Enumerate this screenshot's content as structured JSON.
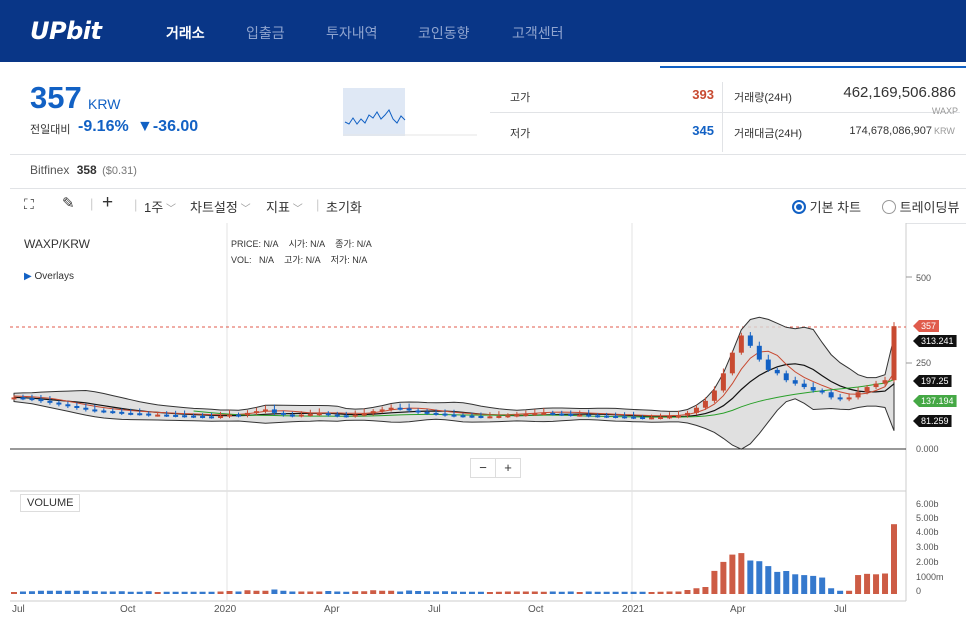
{
  "nav": {
    "logo": "UPbit",
    "items": [
      "거래소",
      "입출금",
      "투자내역",
      "코인동향",
      "고객센터"
    ]
  },
  "ticker": {
    "price": "357",
    "unit": "KRW",
    "prev_label": "전일대비",
    "change_pct": "-9.16%",
    "change_abs": "▼-36.00",
    "high_label": "고가",
    "high": "393",
    "low_label": "저가",
    "low": "345",
    "vol_label": "거래량(24H)",
    "vol_value": "462,169,506.886",
    "vol_unit": "WAXP",
    "amt_label": "거래대금(24H)",
    "amt_value": "174,678,086,907",
    "amt_unit": "KRW"
  },
  "bitfinex": {
    "label": "Bitfinex",
    "price": "358",
    "usd": "($0.31)"
  },
  "toolbar": {
    "interval": "1주",
    "chart_settings": "차트설정",
    "indicators": "지표",
    "reset": "초기화",
    "basic_chart": "기본 차트",
    "trading_view": "트레이딩뷰"
  },
  "chart": {
    "symbol": "WAXP/KRW",
    "overlays": "Overlays",
    "legend": {
      "price": "PRICE:",
      "open": "시가:",
      "close": "종가:",
      "vol": "VOL:",
      "high": "고가:",
      "low": "저가:",
      "na": "N/A"
    },
    "volume_label": "VOLUME",
    "price_axis": [
      "500",
      "250",
      "0.000"
    ],
    "price_tags": [
      "357",
      "313.241",
      "197.25",
      "137.194",
      "81.259"
    ],
    "volume_axis": [
      "6.00b",
      "5.00b",
      "4.00b",
      "3.00b",
      "2.00b",
      "1000m",
      "0"
    ],
    "x_axis": [
      "Jul",
      "Oct",
      "2020",
      "Apr",
      "Jul",
      "Oct",
      "2021",
      "Apr",
      "Jul"
    ],
    "zoom_out": "−",
    "zoom_in": "+",
    "colors": {
      "up": "#c84a31",
      "down": "#1261c4",
      "band": "#d8d8d8",
      "ma_green": "#2aa02a",
      "ma_red": "#c84a31"
    }
  },
  "chart_data": {
    "type": "candlestick",
    "series": [
      {
        "name": "WAXP/KRW",
        "values": [
          150,
          148,
          145,
          140,
          135,
          130,
          125,
          120,
          115,
          112,
          110,
          108,
          105,
          104,
          103,
          100,
          100,
          99,
          98,
          97,
          96,
          95,
          94,
          96,
          100,
          98,
          105,
          110,
          115,
          105,
          100,
          98,
          100,
          102,
          104,
          100,
          98,
          97,
          100,
          103,
          110,
          115,
          120,
          118,
          112,
          108,
          105,
          103,
          100,
          98,
          97,
          96,
          95,
          95,
          96,
          98,
          100,
          102,
          104,
          105,
          103,
          102,
          100,
          100,
          98,
          97,
          96,
          95,
          94,
          93,
          92,
          92,
          93,
          95,
          97,
          105,
          120,
          140,
          170,
          220,
          280,
          330,
          300,
          260,
          230,
          220,
          200,
          190,
          180,
          170,
          165,
          150,
          145,
          150,
          165,
          180,
          190,
          200,
          357
        ]
      }
    ]
  }
}
